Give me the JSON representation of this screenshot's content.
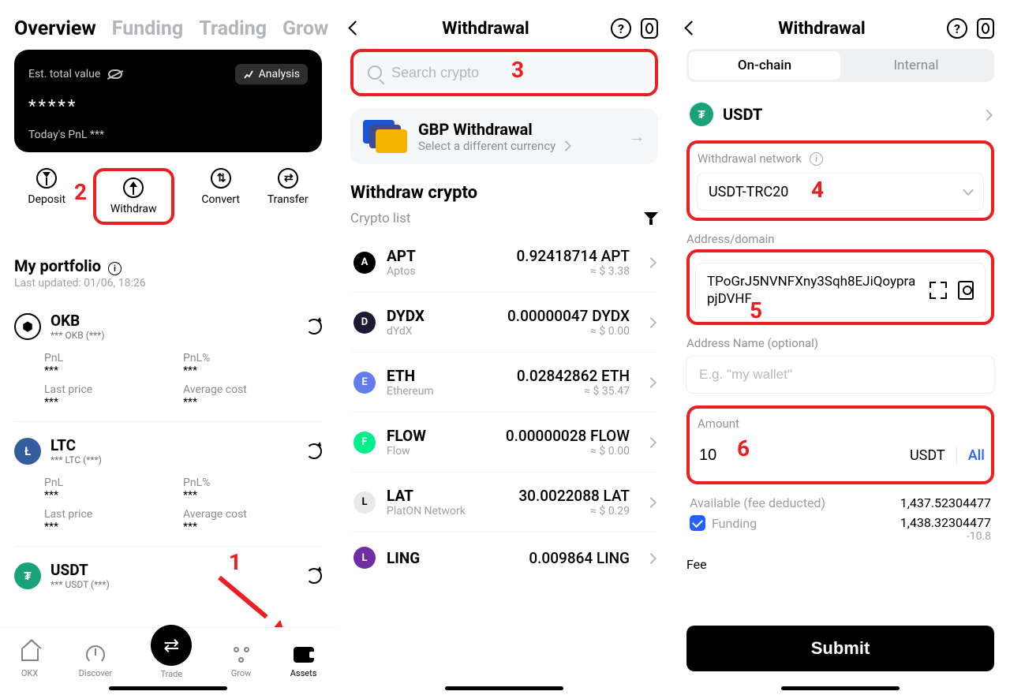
{
  "panel1": {
    "tabs": [
      "Overview",
      "Funding",
      "Trading",
      "Grow"
    ],
    "card": {
      "est_label": "Est. total value",
      "analysis": "Analysis",
      "masked_value": "*****",
      "pnl_label": "Today's PnL",
      "pnl_value": "***"
    },
    "actions": {
      "deposit": "Deposit",
      "withdraw": "Withdraw",
      "convert": "Convert",
      "transfer": "Transfer"
    },
    "portfolio": {
      "title": "My portfolio",
      "updated": "Last updated: 01/06, 18:26"
    },
    "assets": [
      {
        "sym": "OKB",
        "sub": "*** OKB  (***)",
        "icon": "⬢",
        "bg": "#fff",
        "color": "#000",
        "pnl_l": "PnL",
        "pnl_v": "***",
        "pnlp_l": "PnL%",
        "pnlp_v": "***",
        "lp_l": "Last price",
        "lp_v": "***",
        "ac_l": "Average cost",
        "ac_v": "***"
      },
      {
        "sym": "LTC",
        "sub": "*** LTC  (***)",
        "icon": "Ł",
        "bg": "#345d9d",
        "color": "#fff",
        "pnl_l": "PnL",
        "pnl_v": "***",
        "pnlp_l": "PnL%",
        "pnlp_v": "***",
        "lp_l": "Last price",
        "lp_v": "***",
        "ac_l": "Average cost",
        "ac_v": "***"
      },
      {
        "sym": "USDT",
        "sub": "*** USDT  (***)",
        "icon": "₮",
        "bg": "#1ba27a",
        "color": "#fff"
      }
    ],
    "tabbar": {
      "okx": "OKX",
      "discover": "Discover",
      "trade": "Trade",
      "grow": "Grow",
      "assets": "Assets"
    }
  },
  "panel2": {
    "title": "Withdrawal",
    "search_placeholder": "Search crypto",
    "gbp": {
      "title": "GBP Withdrawal",
      "sub": "Select a different currency"
    },
    "section_title": "Withdraw crypto",
    "list_label": "Crypto list",
    "coins": [
      {
        "sym": "APT",
        "name": "Aptos",
        "amt": "0.92418714 APT",
        "usd": "≈ $ 3.38",
        "bg": "#000"
      },
      {
        "sym": "DYDX",
        "name": "dYdX",
        "amt": "0.00000047 DYDX",
        "usd": "≈ $ 0.00",
        "bg": "#1e1a33"
      },
      {
        "sym": "ETH",
        "name": "Ethereum",
        "amt": "0.02842862 ETH",
        "usd": "≈ $ 35.47",
        "bg": "#627eea"
      },
      {
        "sym": "FLOW",
        "name": "Flow",
        "amt": "0.00000028 FLOW",
        "usd": "≈ $ 0.00",
        "bg": "#00ef8b"
      },
      {
        "sym": "LAT",
        "name": "PlatON Network",
        "amt": "30.0022088 LAT",
        "usd": "≈ $ 0.29",
        "bg": "#e7e9eb",
        "fg": "#000"
      },
      {
        "sym": "LING",
        "name": "",
        "amt": "0.009864 LING",
        "usd": "",
        "bg": "#6e2ca5"
      }
    ]
  },
  "panel3": {
    "title": "Withdrawal",
    "seg": {
      "onchain": "On-chain",
      "internal": "Internal"
    },
    "asset": "USDT",
    "network": {
      "label": "Withdrawal network",
      "value": "USDT-TRC20"
    },
    "addr": {
      "label": "Address/domain",
      "value": "TPoGrJ5NVNFXny3Sqh8EJiQoyprapjDVHF"
    },
    "addr_name": {
      "label": "Address Name (optional)",
      "placeholder": "E.g. \"my wallet\""
    },
    "amount": {
      "label": "Amount",
      "value": "10",
      "unit": "USDT",
      "all": "All"
    },
    "available": {
      "label": "Available (fee deducted)",
      "value": "1,437.52304477"
    },
    "funding": {
      "label": "Funding",
      "value": "1,438.32304477",
      "delta": "-10.8"
    },
    "fee_label": "Fee",
    "submit": "Submit"
  },
  "annot": {
    "n1": "1",
    "n2": "2",
    "n3": "3",
    "n4": "4",
    "n5": "5",
    "n6": "6"
  }
}
